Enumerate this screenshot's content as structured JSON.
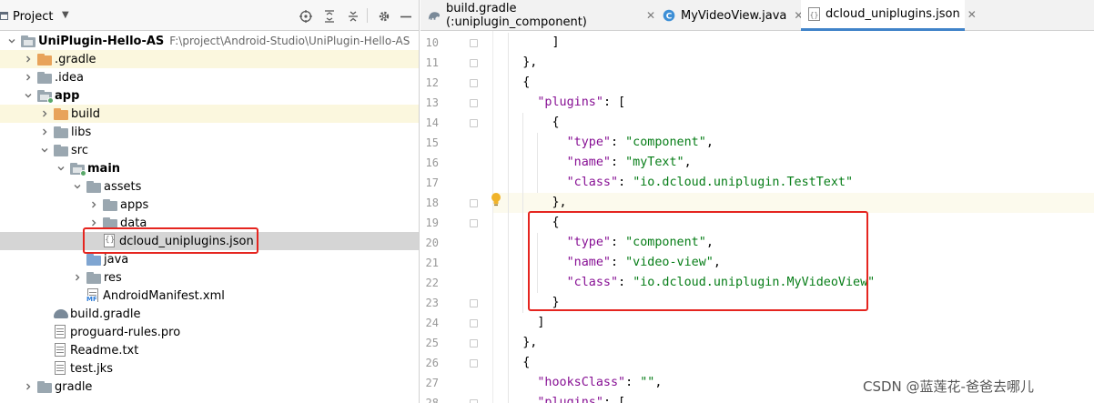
{
  "project_panel": {
    "title": "Project",
    "toolbar_icons": [
      "crosshair-icon",
      "expand-all-icon",
      "collapse-all-icon",
      "gear-icon",
      "hide-icon"
    ],
    "tree": [
      {
        "label": "UniPlugin-Hello-AS",
        "path": "F:\\project\\Android-Studio\\UniPlugin-Hello-AS",
        "depth": 0,
        "arrow": "down",
        "icon": "module",
        "bold": true
      },
      {
        "label": ".gradle",
        "depth": 1,
        "arrow": "right",
        "icon": "orange",
        "hl": true
      },
      {
        "label": ".idea",
        "depth": 1,
        "arrow": "right",
        "icon": "grey"
      },
      {
        "label": "app",
        "depth": 1,
        "arrow": "down",
        "icon": "module-dot",
        "bold": true
      },
      {
        "label": "build",
        "depth": 2,
        "arrow": "right",
        "icon": "orange",
        "hl": true
      },
      {
        "label": "libs",
        "depth": 2,
        "arrow": "right",
        "icon": "grey"
      },
      {
        "label": "src",
        "depth": 2,
        "arrow": "down",
        "icon": "grey"
      },
      {
        "label": "main",
        "depth": 3,
        "arrow": "down",
        "icon": "module-dot",
        "bold": true
      },
      {
        "label": "assets",
        "depth": 4,
        "arrow": "down",
        "icon": "grey"
      },
      {
        "label": "apps",
        "depth": 5,
        "arrow": "right",
        "icon": "grey"
      },
      {
        "label": "data",
        "depth": 5,
        "arrow": "right",
        "icon": "grey"
      },
      {
        "label": "dcloud_uniplugins.json",
        "depth": 5,
        "arrow": "none",
        "icon": "json",
        "selected": true
      },
      {
        "label": "java",
        "depth": 4,
        "arrow": "none",
        "icon": "blue"
      },
      {
        "label": "res",
        "depth": 4,
        "arrow": "right",
        "icon": "grey"
      },
      {
        "label": "AndroidManifest.xml",
        "depth": 4,
        "arrow": "none",
        "icon": "manifest"
      },
      {
        "label": "build.gradle",
        "depth": 2,
        "arrow": "none",
        "icon": "gradle"
      },
      {
        "label": "proguard-rules.pro",
        "depth": 2,
        "arrow": "none",
        "icon": "text"
      },
      {
        "label": "Readme.txt",
        "depth": 2,
        "arrow": "none",
        "icon": "text"
      },
      {
        "label": "test.jks",
        "depth": 2,
        "arrow": "none",
        "icon": "jks"
      },
      {
        "label": "gradle",
        "depth": 1,
        "arrow": "right",
        "icon": "grey"
      }
    ]
  },
  "editor": {
    "tabs": [
      {
        "label": "build.gradle (:uniplugin_component)",
        "icon": "gradle",
        "active": false
      },
      {
        "label": "MyVideoView.java",
        "icon": "class",
        "active": false
      },
      {
        "label": "dcloud_uniplugins.json",
        "icon": "json",
        "active": true
      }
    ],
    "lines": [
      {
        "n": "10",
        "tokens": [
          [
            "p",
            "        ]"
          ]
        ]
      },
      {
        "n": "11",
        "tokens": [
          [
            "p",
            "    },"
          ]
        ]
      },
      {
        "n": "12",
        "tokens": [
          [
            "p",
            "    {"
          ]
        ]
      },
      {
        "n": "13",
        "tokens": [
          [
            "p",
            "      "
          ],
          [
            "k",
            "\"plugins\""
          ],
          [
            "p",
            ": ["
          ]
        ]
      },
      {
        "n": "14",
        "tokens": [
          [
            "p",
            "        {"
          ]
        ]
      },
      {
        "n": "15",
        "tokens": [
          [
            "p",
            "          "
          ],
          [
            "k",
            "\"type\""
          ],
          [
            "p",
            ": "
          ],
          [
            "s",
            "\"component\""
          ],
          [
            "p",
            ","
          ]
        ]
      },
      {
        "n": "16",
        "tokens": [
          [
            "p",
            "          "
          ],
          [
            "k",
            "\"name\""
          ],
          [
            "p",
            ": "
          ],
          [
            "s",
            "\"myText\""
          ],
          [
            "p",
            ","
          ]
        ]
      },
      {
        "n": "17",
        "tokens": [
          [
            "p",
            "          "
          ],
          [
            "k",
            "\"class\""
          ],
          [
            "p",
            ": "
          ],
          [
            "s",
            "\"io.dcloud.uniplugin.TestText\""
          ]
        ]
      },
      {
        "n": "18",
        "tokens": [
          [
            "p",
            "        },"
          ]
        ],
        "current": true
      },
      {
        "n": "19",
        "tokens": [
          [
            "p",
            "        {"
          ]
        ]
      },
      {
        "n": "20",
        "tokens": [
          [
            "p",
            "          "
          ],
          [
            "k",
            "\"type\""
          ],
          [
            "p",
            ": "
          ],
          [
            "s",
            "\"component\""
          ],
          [
            "p",
            ","
          ]
        ]
      },
      {
        "n": "21",
        "tokens": [
          [
            "p",
            "          "
          ],
          [
            "k",
            "\"name\""
          ],
          [
            "p",
            ": "
          ],
          [
            "s",
            "\"video-view\""
          ],
          [
            "p",
            ","
          ]
        ]
      },
      {
        "n": "22",
        "tokens": [
          [
            "p",
            "          "
          ],
          [
            "k",
            "\"class\""
          ],
          [
            "p",
            ": "
          ],
          [
            "s",
            "\"io.dcloud.uniplugin.MyVideoView\""
          ]
        ]
      },
      {
        "n": "23",
        "tokens": [
          [
            "p",
            "        }"
          ]
        ]
      },
      {
        "n": "24",
        "tokens": [
          [
            "p",
            "      ]"
          ]
        ]
      },
      {
        "n": "25",
        "tokens": [
          [
            "p",
            "    },"
          ]
        ]
      },
      {
        "n": "26",
        "tokens": [
          [
            "p",
            "    {"
          ]
        ]
      },
      {
        "n": "27",
        "tokens": [
          [
            "p",
            "      "
          ],
          [
            "k",
            "\"hooksClass\""
          ],
          [
            "p",
            ": "
          ],
          [
            "s",
            "\"\""
          ],
          [
            "p",
            ","
          ]
        ]
      },
      {
        "n": "28",
        "tokens": [
          [
            "p",
            "      "
          ],
          [
            "k",
            "\"plugins\""
          ],
          [
            "p",
            ": ["
          ]
        ]
      }
    ]
  },
  "watermark": "CSDN @蓝莲花-爸爸去哪儿"
}
